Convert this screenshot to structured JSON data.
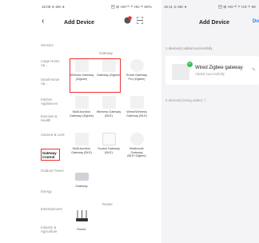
{
  "left": {
    "status_time": "15:08 ⊘ 69c ●",
    "status_right": "回 ⊞ HD⁴ᴳ ᵃˡ HD ᵃˡ 98%",
    "title": "Add Device",
    "categories": [
      "Sensors",
      "Large Home Ap...",
      "Small Home Ap...",
      "Kitchen Appliances",
      "Exercise & Health",
      "Camera & Lock",
      "Gateway Control",
      "Outdoor Travel",
      "Energy",
      "Entertainment",
      "Industry & Agriculture"
    ],
    "sections": {
      "gateway": "Gateway",
      "router": "Router"
    },
    "devices": [
      "Wireless Gateway (Zigbee)",
      "Gateway (Zigbee)",
      "Smart Gateway Pro (Zigbee)",
      "Multi-function Gateway (Zigbee)",
      "Wireless Gateway (BLE)",
      "Wired/Wireless Gateway (BLE)",
      "Multi-function Gateway (BLE)",
      "Socket Gateway (BLE)",
      "Multimode Gateway (BLE+Zigbee)",
      "Gateway",
      "Router"
    ]
  },
  "right": {
    "status_time": "15:11 ⊘ 69c ●",
    "status_right": "回 ⊞ HD⁴ᴳ ᵃˡ HD ᵃˡ 98",
    "title": "Add Device",
    "done": "Do",
    "added_count": "1 device(s) added successfully",
    "device_name": "Wired Zigbee gateway",
    "device_status": "Added successfully",
    "adding_count": "0 device(s) being added"
  },
  "colors": {
    "highlight": "#e33333",
    "success": "#3cbf5a",
    "accent": "#1e7cf2"
  }
}
